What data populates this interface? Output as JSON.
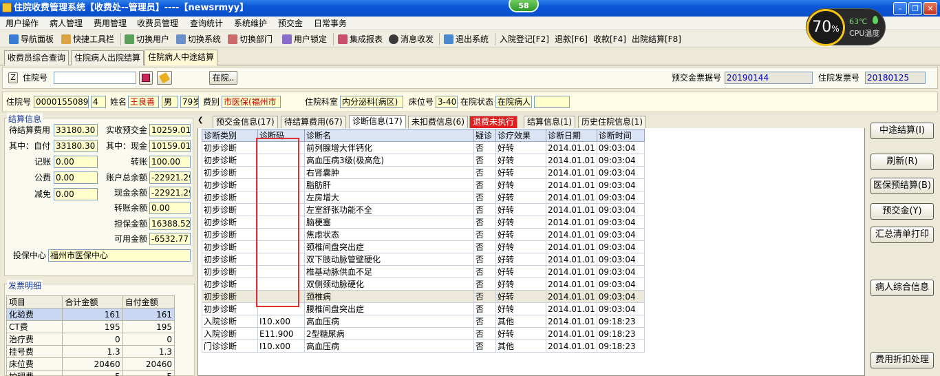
{
  "window": {
    "title": "住院收费管理系统【收费处--管理员】----【newsrmyy】",
    "badge": "58"
  },
  "cpu": {
    "percent": "70",
    "unit": "%",
    "temp": "63℃",
    "label": "CPU温度"
  },
  "menu": [
    "用户操作",
    "病人管理",
    "费用管理",
    "收费员管理",
    "查询统计",
    "系统维护",
    "预交金",
    "日常事务"
  ],
  "toolbar": [
    "导航面板",
    "快捷工具栏",
    "切换用户",
    "切换系统",
    "切换部门",
    "用户锁定",
    "集成报表",
    "消息收发",
    "退出系统",
    "入院登记[F2]",
    "退款[F6]",
    "收款[F4]",
    "出院结算[F8]"
  ],
  "module_tabs": [
    "收费员综合查询",
    "住院病人出院结算",
    "住院病人中途结算"
  ],
  "search": {
    "z_label": "Z",
    "inpatient_no_label": "住院号",
    "inpatient_no_value": "",
    "in_hospital_btn": "在院..",
    "prepay_ticket_label": "预交金票据号",
    "prepay_ticket_value": "20190144",
    "invoice_label": "住院发票号",
    "invoice_value": "20180125"
  },
  "patient": {
    "inpatient_no_label": "住院号",
    "inpatient_no": "0000155089",
    "times": "4",
    "name_label": "姓名",
    "name": "王良善",
    "gender": "男",
    "age": "79岁",
    "fee_type_label": "费别",
    "fee_type": "市医保(福州市",
    "dept_label": "住院科室",
    "dept": "内分泌科(病区)",
    "bed_label": "床位号",
    "bed": "3-401",
    "status_label": "在院状态",
    "status": "在院病人",
    "extra": ""
  },
  "settlement": {
    "title": "结算信息",
    "pending_label": "待结算费用",
    "pending": "33180.30",
    "self_pay_label": "其中：自付",
    "self_pay": "33180.30",
    "account_label": "记账",
    "account": "0.00",
    "public_label": "公费",
    "public": "0.00",
    "reduce_label": "减免",
    "reduce": "0.00",
    "received_label": "实收预交金",
    "received": "10259.01",
    "cash_label": "其中：现金",
    "cash": "10159.01",
    "transfer_label": "转账",
    "transfer": "100.00",
    "acct_total_label": "账户总余额",
    "acct_total": "-22921.29",
    "cash_bal_label": "现金余额",
    "cash_bal": "-22921.29",
    "transfer_bal_label": "转账余额",
    "transfer_bal": "0.00",
    "guarantee_label": "担保金额",
    "guarantee": "16388.52",
    "available_label": "可用金额",
    "available": "-6532.77",
    "insure_center_label": "投保中心",
    "insure_center": "福州市医保中心"
  },
  "invoice": {
    "title": "发票明细",
    "headers": [
      "项目",
      "合计金额",
      "自付金额"
    ],
    "rows": [
      [
        "化验费",
        "161",
        "161"
      ],
      [
        "CT费",
        "195",
        "195"
      ],
      [
        "治疗费",
        "0",
        "0"
      ],
      [
        "挂号费",
        "1.3",
        "1.3"
      ],
      [
        "床位费",
        "20460",
        "20460"
      ],
      [
        "护理费",
        "5",
        "5"
      ]
    ]
  },
  "subtabs": [
    "预交金信息(17)",
    "待结算费用(67)",
    "诊断信息(17)",
    "未扣费信息(6)",
    "退费未执行",
    "结算信息(1)",
    "历史住院信息(1)"
  ],
  "diagnosis": {
    "headers": [
      "诊断类别",
      "诊断码",
      "诊断名",
      "疑诊",
      "诊疗效果",
      "诊断日期",
      "诊断时间"
    ],
    "rows": [
      [
        "初步诊断",
        "",
        "前列腺增大伴钙化",
        "否",
        "好转",
        "2014.01.01",
        "09:03:04"
      ],
      [
        "初步诊断",
        "",
        "高血压病3级(极高危)",
        "否",
        "好转",
        "2014.01.01",
        "09:03:04"
      ],
      [
        "初步诊断",
        "",
        "右肾囊肿",
        "否",
        "好转",
        "2014.01.01",
        "09:03:04"
      ],
      [
        "初步诊断",
        "",
        "脂肪肝",
        "否",
        "好转",
        "2014.01.01",
        "09:03:04"
      ],
      [
        "初步诊断",
        "",
        "左房增大",
        "否",
        "好转",
        "2014.01.01",
        "09:03:04"
      ],
      [
        "初步诊断",
        "",
        "左室舒张功能不全",
        "否",
        "好转",
        "2014.01.01",
        "09:03:04"
      ],
      [
        "初步诊断",
        "",
        "脑梗塞",
        "否",
        "好转",
        "2014.01.01",
        "09:03:04"
      ],
      [
        "初步诊断",
        "",
        "焦虑状态",
        "否",
        "好转",
        "2014.01.01",
        "09:03:04"
      ],
      [
        "初步诊断",
        "",
        "颈椎间盘突出症",
        "否",
        "好转",
        "2014.01.01",
        "09:03:04"
      ],
      [
        "初步诊断",
        "",
        "双下肢动脉管壁硬化",
        "否",
        "好转",
        "2014.01.01",
        "09:03:04"
      ],
      [
        "初步诊断",
        "",
        "椎基动脉供血不足",
        "否",
        "好转",
        "2014.01.01",
        "09:03:04"
      ],
      [
        "初步诊断",
        "",
        "双侧颈动脉硬化",
        "否",
        "好转",
        "2014.01.01",
        "09:03:04"
      ],
      [
        "初步诊断",
        "",
        "颈椎病",
        "否",
        "好转",
        "2014.01.01",
        "09:03:04"
      ],
      [
        "初步诊断",
        "",
        "腰椎间盘突出症",
        "否",
        "好转",
        "2014.01.01",
        "09:03:04"
      ],
      [
        "入院诊断",
        "I10.x00",
        "高血压病",
        "否",
        "其他",
        "2014.01.01",
        "09:18:23"
      ],
      [
        "入院诊断",
        "E11.900",
        "2型糖尿病",
        "否",
        "好转",
        "2014.01.01",
        "09:18:23"
      ],
      [
        "门诊诊断",
        "I10.x00",
        "高血压病",
        "否",
        "其他",
        "2014.01.01",
        "09:18:23"
      ]
    ]
  },
  "right_buttons": [
    "中途结算(I)",
    "刷新(R)",
    "医保预结算(B)",
    "预交金(Y)",
    "汇总清单打印",
    "病人综合信息",
    "费用折扣处理"
  ],
  "colors": {
    "accent_blue": "#0a56d8",
    "highlight_red": "#e03030",
    "field_yellow": "#ffffcc"
  }
}
